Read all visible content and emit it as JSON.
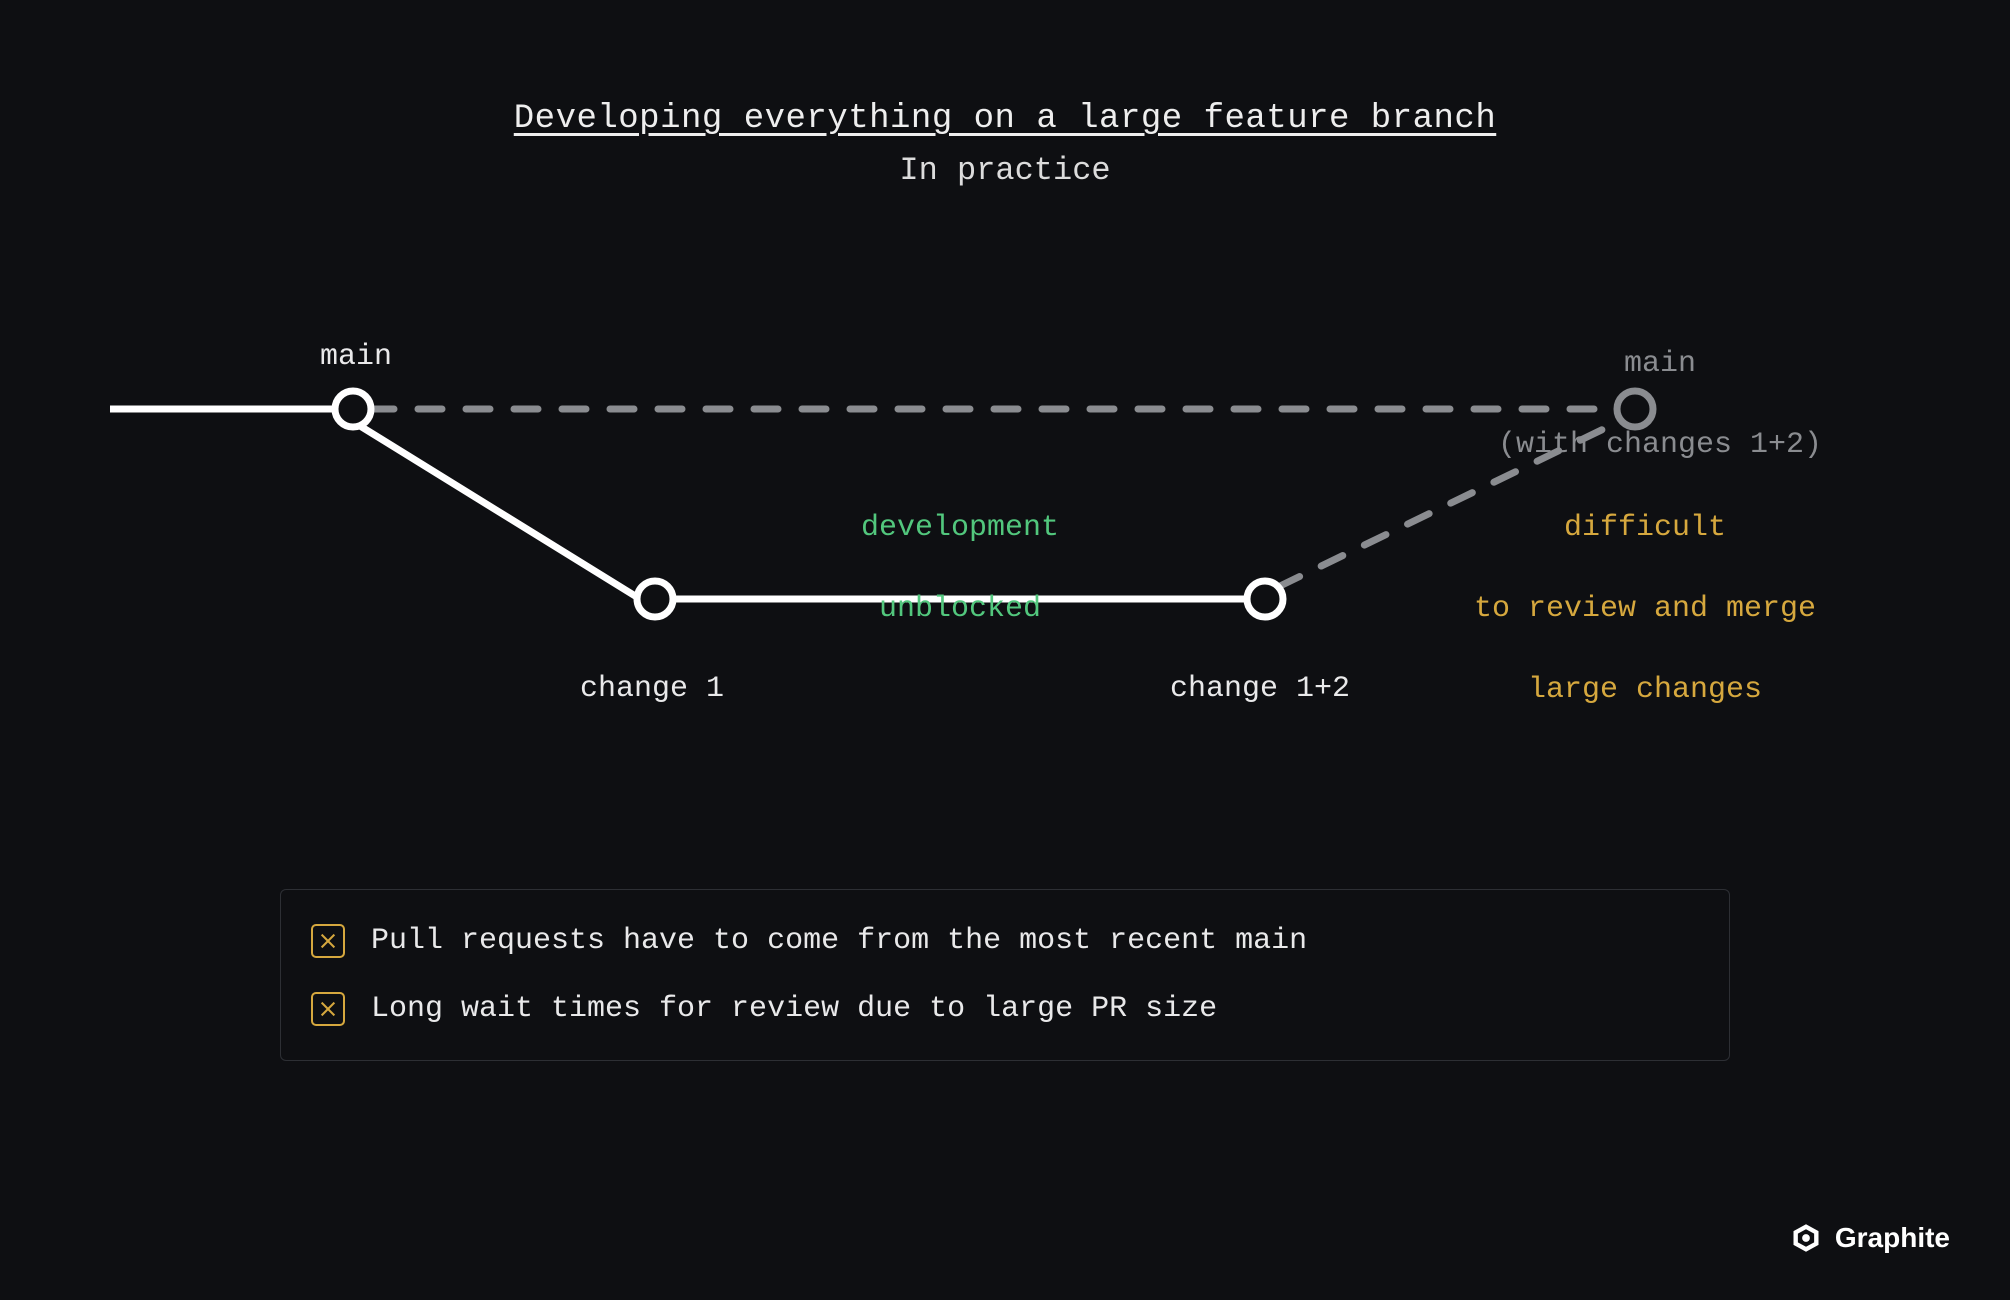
{
  "header": {
    "title": "Developing everything on a large feature branch",
    "subtitle": "In practice"
  },
  "nodes": {
    "main": "main",
    "main_future_line1": "main",
    "main_future_line2": "(with changes 1+2)",
    "change1": "change 1",
    "change12": "change 1+2"
  },
  "annotations": {
    "dev_unblocked_line1": "development",
    "dev_unblocked_line2": "unblocked",
    "difficult_line1": "difficult",
    "difficult_line2": "to review and merge",
    "difficult_line3": "large changes"
  },
  "summary": {
    "item1": "Pull requests have to come from the most recent main",
    "item2": "Long wait times for review due to large PR size"
  },
  "brand": {
    "name": "Graphite"
  },
  "colors": {
    "bg": "#0e0f12",
    "fg": "#e9e9ea",
    "muted": "#8a8c90",
    "green": "#52c77d",
    "yellow": "#d6a83e",
    "border": "#2d2f34"
  }
}
